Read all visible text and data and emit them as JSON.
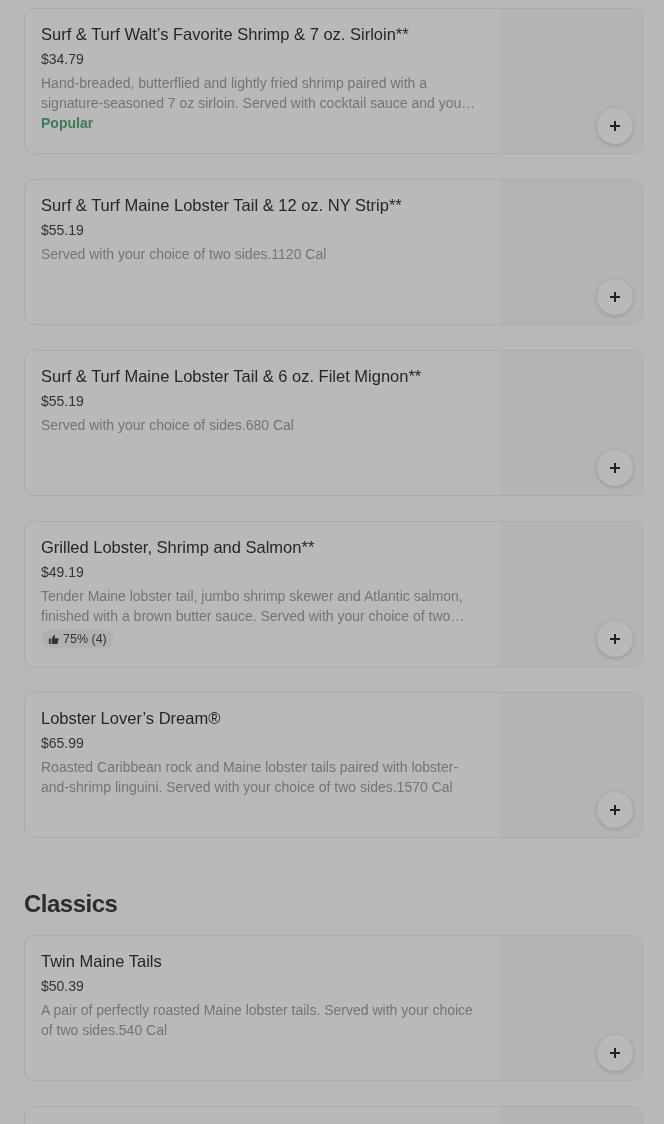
{
  "sections": [
    {
      "items": [
        {
          "title": "Surf & Turf Walt’s Favorite Shrimp & 7 oz. Sirloin**",
          "price": "$34.79",
          "description": "Hand-breaded, butterflied and lightly fried shrimp paired with a signature-seasoned 7 oz sirloin. Served with cocktail sauce and you…",
          "tag": {
            "kind": "popular",
            "text": "Popular"
          }
        },
        {
          "title": "Surf & Turf Maine Lobster Tail & 12 oz. NY Strip**",
          "price": "$55.19",
          "description": "Served with your choice of two sides.1120 Cal"
        },
        {
          "title": "Surf & Turf Maine Lobster Tail & 6 oz. Filet Mignon**",
          "price": "$55.19",
          "description": "Served with your choice of sides.680 Cal"
        },
        {
          "title": "Grilled Lobster, Shrimp and Salmon**",
          "price": "$49.19",
          "description": "Tender Maine lobster tail, jumbo shrimp skewer and Atlantic salmon, finished with a brown butter sauce. Served with your choice of two…",
          "tag": {
            "kind": "rating",
            "text": "75% (4)"
          }
        },
        {
          "title": "Lobster Lover’s Dream®",
          "price": "$65.99",
          "description": "Roasted Caribbean rock and Maine lobster tails paired with lobster-and-shrimp linguini. Served with your choice of two sides.1570 Cal"
        }
      ]
    },
    {
      "heading": "Classics",
      "items": [
        {
          "title": "Twin Maine Tails",
          "price": "$50.39",
          "description": "A pair of perfectly roasted Maine lobster tails. Served with your choice of two sides.540 Cal"
        }
      ]
    }
  ]
}
